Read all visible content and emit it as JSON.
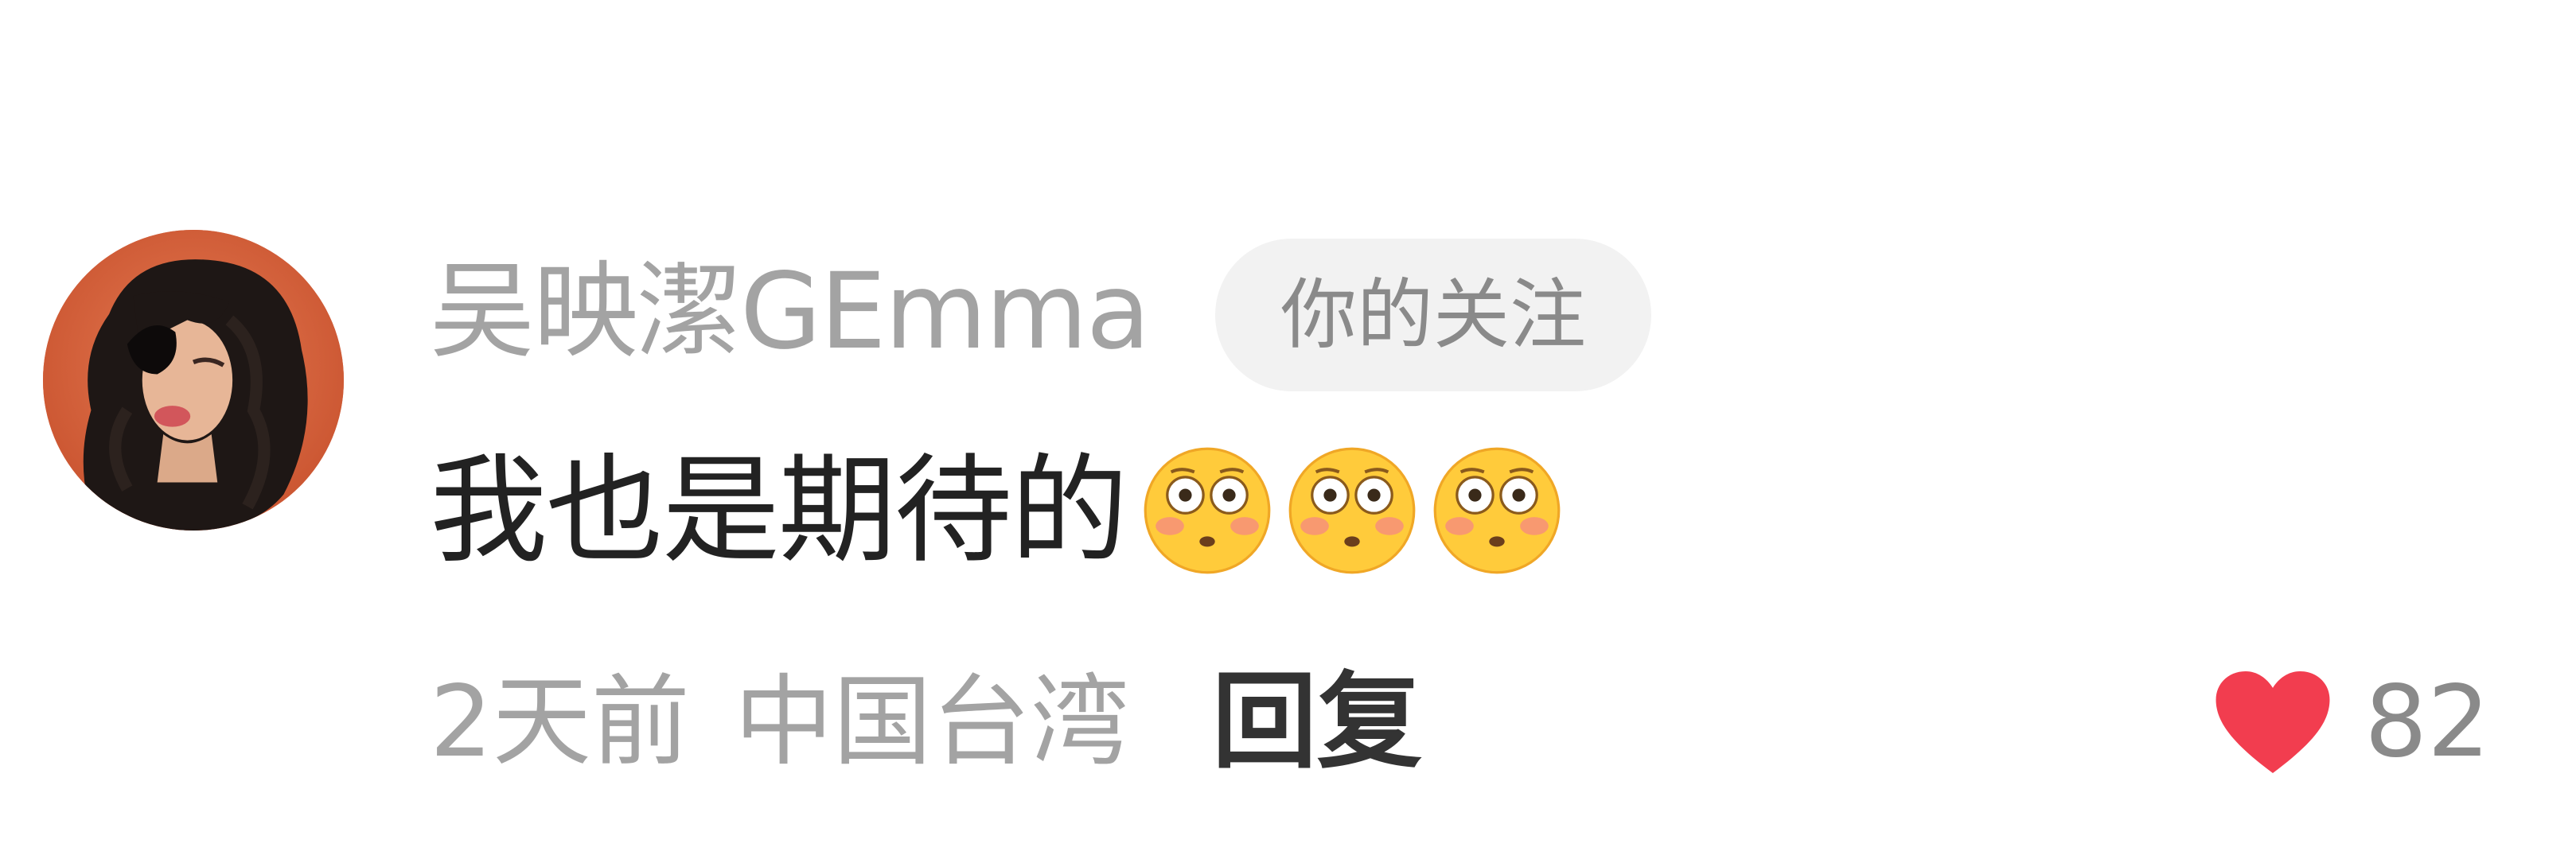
{
  "comment": {
    "user": {
      "name": "吴映潔GEmma",
      "avatar_icon": "user-avatar"
    },
    "follow_badge": "你的关注",
    "text": "我也是期待的",
    "emojis": [
      "flushed-face-icon",
      "flushed-face-icon",
      "flushed-face-icon"
    ],
    "time": "2天前",
    "location": "中国台湾",
    "reply_label": "回复",
    "like": {
      "icon": "heart-icon",
      "count": "82",
      "color": "#f23d4f"
    }
  }
}
